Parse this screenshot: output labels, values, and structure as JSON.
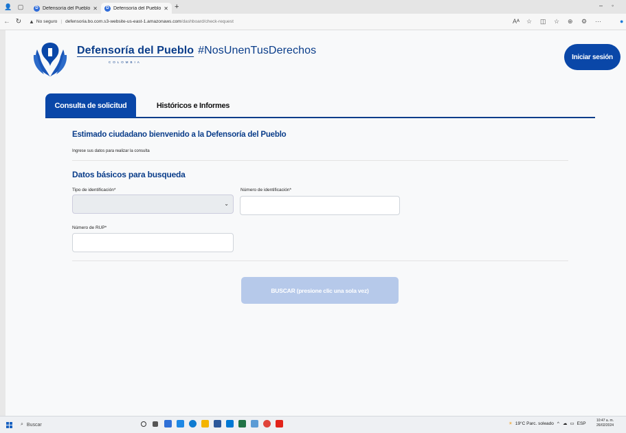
{
  "browser": {
    "tabs": [
      {
        "title": "Defensoría del Pueblo",
        "active": false
      },
      {
        "title": "Defensoría del Pueblo",
        "active": true
      }
    ],
    "security_label": "No seguro",
    "url_host": "defensoria.bo.com.s3-website-us-east-1.amazonaws.com",
    "url_path": "/dashboard/check-request"
  },
  "header": {
    "brand_name": "Defensoría del Pueblo",
    "brand_hashtag": "#NosUnenTusDerechos",
    "brand_country": "COLOMBIA",
    "login_label": "Iniciar sesión"
  },
  "nav": {
    "tab_consulta": "Consulta de solicitud",
    "tab_historicos": "Históricos e Informes"
  },
  "form": {
    "welcome": "Estimado ciudadano bienvenido a la Defensoría del Pueblo",
    "instructions": "Ingrese sus datos para realizar la consulta",
    "section_title": "Datos básicos para busqueda",
    "tipo_label": "Tipo de identificación*",
    "tipo_value": "",
    "numero_label": "Número de identificación*",
    "numero_value": "",
    "rup_label": "Número de RUP*",
    "rup_value": "",
    "search_label": "BUSCAR (presione clic una sola vez)"
  },
  "taskbar": {
    "search_label": "Buscar",
    "weather": "19°C  Parc. soleado",
    "lang": "ESP",
    "time": "10:47 a. m.",
    "date": "26/02/2024"
  },
  "colors": {
    "primary": "#0a47a8",
    "brand_text": "#0a3d8a",
    "disabled_button": "#b6c9ea"
  }
}
